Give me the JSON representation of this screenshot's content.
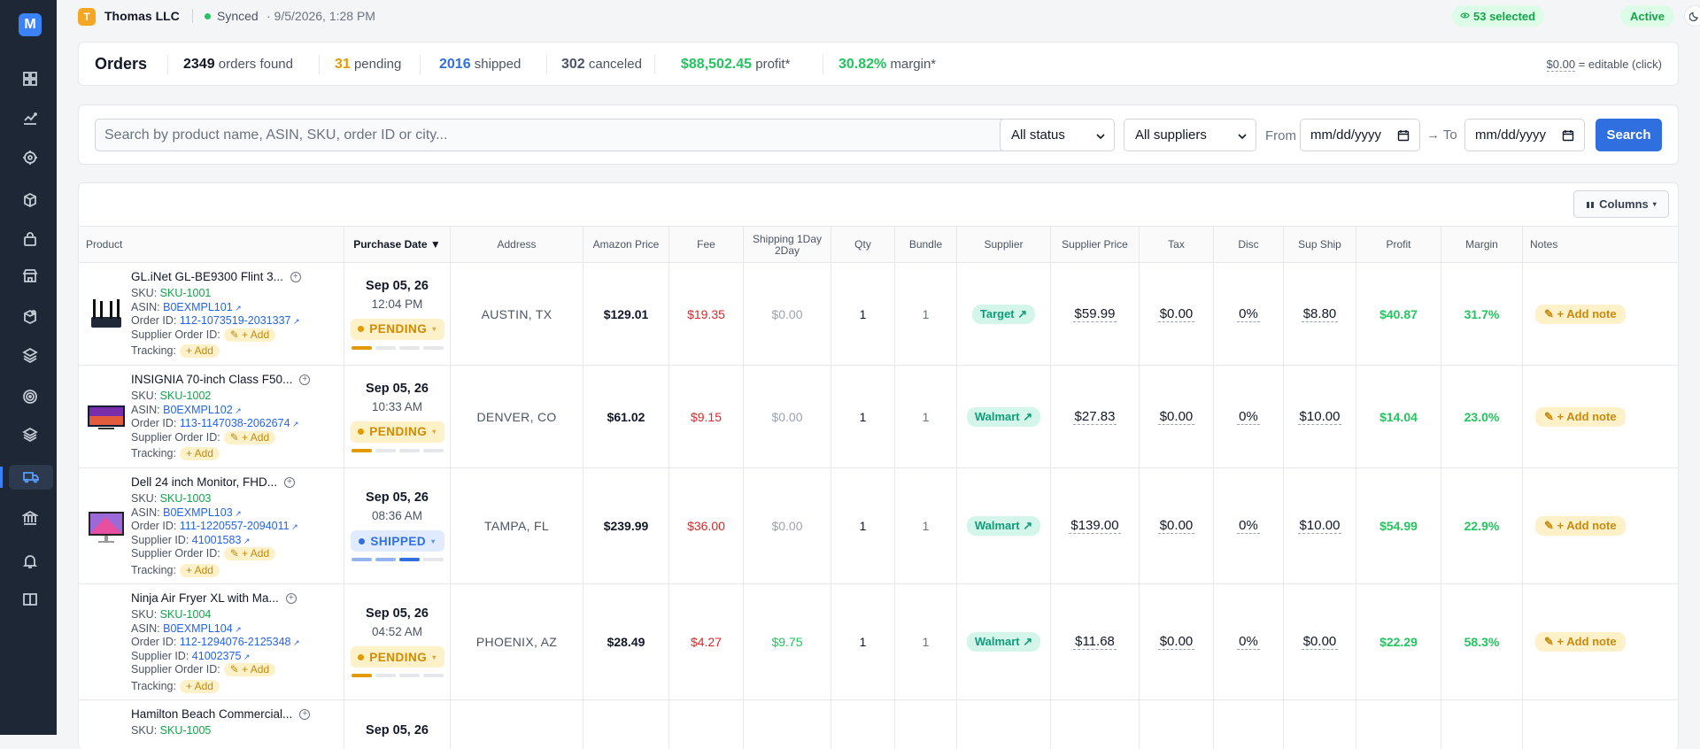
{
  "app": {
    "logo_letter": "M"
  },
  "topbar": {
    "company_initial": "T",
    "company_name": "Thomas LLC",
    "sync_label": "Synced",
    "sync_time": "· 9/5/2026, 1:28 PM",
    "selected_label": "53 selected",
    "status_label": "Active"
  },
  "sidebar": {
    "icons": [
      "dashboard-icon",
      "analytics-icon",
      "target-icon",
      "package-icon",
      "shopping-bag-icon",
      "store-icon",
      "box-tag-icon",
      "layers-icon",
      "radar-icon",
      "stack-icon",
      "truck-icon",
      "bank-icon",
      "bell-icon",
      "book-icon"
    ],
    "active": "truck-icon"
  },
  "summary": {
    "title": "Orders",
    "found_count": "2349",
    "found_label": "orders found",
    "pending_count": "31",
    "pending_label": "pending",
    "shipped_count": "2016",
    "shipped_label": "shipped",
    "canceled_count": "302",
    "canceled_label": "canceled",
    "profit_value": "$88,502.45",
    "profit_label": "profit*",
    "margin_value": "30.82%",
    "margin_label": "margin*",
    "edit_hint_value": "$0.00",
    "edit_hint_text": "= editable (click)"
  },
  "filters": {
    "search_placeholder": "Search by product name, ASIN, SKU, order ID or city...",
    "status_select": "All status",
    "supplier_select": "All suppliers",
    "from_label": "From",
    "to_label": "→ To",
    "date_from_placeholder": "mm/dd/yyyy",
    "date_to_placeholder": "mm/dd/yyyy",
    "search_button": "Search"
  },
  "table": {
    "columns_button": "Columns",
    "headers": [
      "Product",
      "Purchase Date ▼",
      "Address",
      "Amazon Price",
      "Fee",
      "Shipping 1Day 2Day",
      "Qty",
      "Bundle",
      "Supplier",
      "Supplier Price",
      "Tax",
      "Disc",
      "Sup Ship",
      "Profit",
      "Margin",
      "Notes"
    ],
    "labels": {
      "sku": "SKU:",
      "asin": "ASIN:",
      "order_id": "Order ID:",
      "supplier_id": "Supplier ID:",
      "supplier_order_id": "Supplier Order ID:",
      "tracking": "Tracking:",
      "add": "+ Add",
      "add_note": "+ Add note"
    },
    "rows": [
      {
        "name": "GL.iNet GL-BE9300 Flint 3...",
        "sku": "SKU-1001",
        "asin": "B0EXMPL101",
        "order_id": "112-1073519-2031337",
        "supplier_id": "",
        "date": "Sep 05, 26",
        "time": "12:04 PM",
        "status": "PENDING",
        "status_progress": 0.25,
        "address": "AUSTIN, TX",
        "amazon_price": "$129.01",
        "fee": "$19.35",
        "shipping": "$0.00",
        "qty": "1",
        "bundle": "1",
        "supplier": "Target",
        "supplier_price": "$59.99",
        "tax": "$0.00",
        "disc": "0%",
        "sup_ship": "$8.80",
        "profit": "$40.87",
        "margin": "31.7%",
        "thumb": "router"
      },
      {
        "name": "INSIGNIA 70-inch Class F50...",
        "sku": "SKU-1002",
        "asin": "B0EXMPL102",
        "order_id": "113-1147038-2062674",
        "supplier_id": "",
        "date": "Sep 05, 26",
        "time": "10:33 AM",
        "status": "PENDING",
        "status_progress": 0.25,
        "address": "DENVER, CO",
        "amazon_price": "$61.02",
        "fee": "$9.15",
        "shipping": "$0.00",
        "qty": "1",
        "bundle": "1",
        "supplier": "Walmart",
        "supplier_price": "$27.83",
        "tax": "$0.00",
        "disc": "0%",
        "sup_ship": "$10.00",
        "profit": "$14.04",
        "margin": "23.0%",
        "thumb": "tv"
      },
      {
        "name": "Dell 24 inch Monitor, FHD...",
        "sku": "SKU-1003",
        "asin": "B0EXMPL103",
        "order_id": "111-1220557-2094011",
        "supplier_id": "41001583",
        "date": "Sep 05, 26",
        "time": "08:36 AM",
        "status": "SHIPPED",
        "status_progress": 0.75,
        "address": "TAMPA, FL",
        "amazon_price": "$239.99",
        "fee": "$36.00",
        "shipping": "$0.00",
        "qty": "1",
        "bundle": "1",
        "supplier": "Walmart",
        "supplier_price": "$139.00",
        "tax": "$0.00",
        "disc": "0%",
        "sup_ship": "$10.00",
        "profit": "$54.99",
        "margin": "22.9%",
        "thumb": "monitor"
      },
      {
        "name": "Ninja Air Fryer XL with Ma...",
        "sku": "SKU-1004",
        "asin": "B0EXMPL104",
        "order_id": "112-1294076-2125348",
        "supplier_id": "41002375",
        "date": "Sep 05, 26",
        "time": "04:52 AM",
        "status": "PENDING",
        "status_progress": 0.25,
        "address": "PHOENIX, AZ",
        "amazon_price": "$28.49",
        "fee": "$4.27",
        "shipping": "$9.75",
        "qty": "1",
        "bundle": "1",
        "supplier": "Walmart",
        "supplier_price": "$11.68",
        "tax": "$0.00",
        "disc": "0%",
        "sup_ship": "$0.00",
        "profit": "$22.29",
        "margin": "58.3%",
        "thumb": "none"
      },
      {
        "name": "Hamilton Beach Commercial...",
        "sku": "SKU-1005",
        "date": "Sep 05, 26"
      }
    ]
  }
}
